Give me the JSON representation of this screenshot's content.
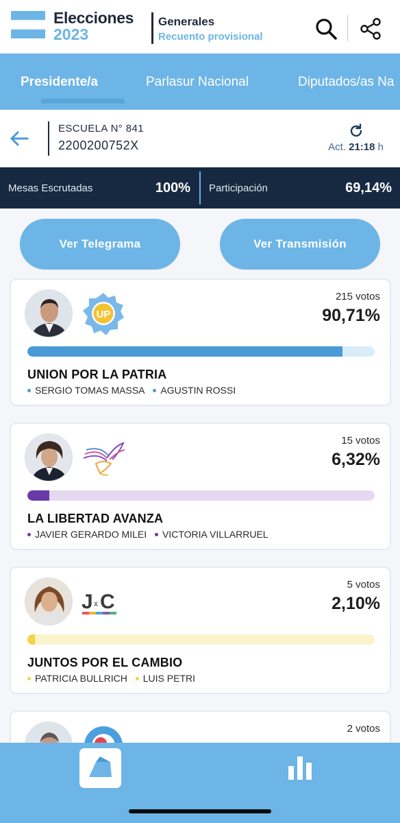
{
  "header": {
    "brand_title": "Elecciones",
    "brand_year": "2023",
    "section_title": "Generales",
    "section_subtitle": "Recuento provisional",
    "icons": [
      "search-icon",
      "share-icon"
    ],
    "colors": {
      "primary": "#6cb5e6",
      "dark": "#172941"
    }
  },
  "tabs": [
    {
      "label": "Presidente/a",
      "active": true
    },
    {
      "label": "Parlasur Nacional",
      "active": false
    },
    {
      "label": "Diputados/as Na",
      "active": false
    }
  ],
  "school": {
    "name": "ESCUELA N° 841",
    "code": "2200200752X",
    "updated_prefix": "Act.",
    "updated_time": "21:18",
    "updated_suffix": "h"
  },
  "stats": {
    "mesas_label": "Mesas Escrutadas",
    "mesas_value": "100%",
    "participacion_label": "Participación",
    "participacion_value": "69,14%"
  },
  "actions": {
    "telegrama": "Ver Telegrama",
    "transmision": "Ver Transmisión"
  },
  "parties": [
    {
      "name": "UNION POR LA PATRIA",
      "votes": "215 votos",
      "percent": "90,71%",
      "share": 0.9071,
      "color": "#4a9ad6",
      "track_color": "#d9ecf8",
      "logo_text": "UP",
      "candidates": [
        "SERGIO TOMAS MASSA",
        "AGUSTIN ROSSI"
      ]
    },
    {
      "name": "LA LIBERTAD AVANZA",
      "votes": "15 votos",
      "percent": "6,32%",
      "share": 0.0632,
      "color": "#6a3aa8",
      "track_color": "#e4d9f0",
      "logo_text": "",
      "candidates": [
        "JAVIER GERARDO MILEI",
        "VICTORIA VILLARRUEL"
      ]
    },
    {
      "name": "JUNTOS POR EL CAMBIO",
      "votes": "5 votos",
      "percent": "2,10%",
      "share": 0.021,
      "color": "#f5d445",
      "track_color": "#fbf3cc",
      "logo_text": "JxC",
      "candidates": [
        "PATRICIA BULLRICH",
        "LUIS PETRI"
      ]
    },
    {
      "votes": "2 votos"
    }
  ]
}
